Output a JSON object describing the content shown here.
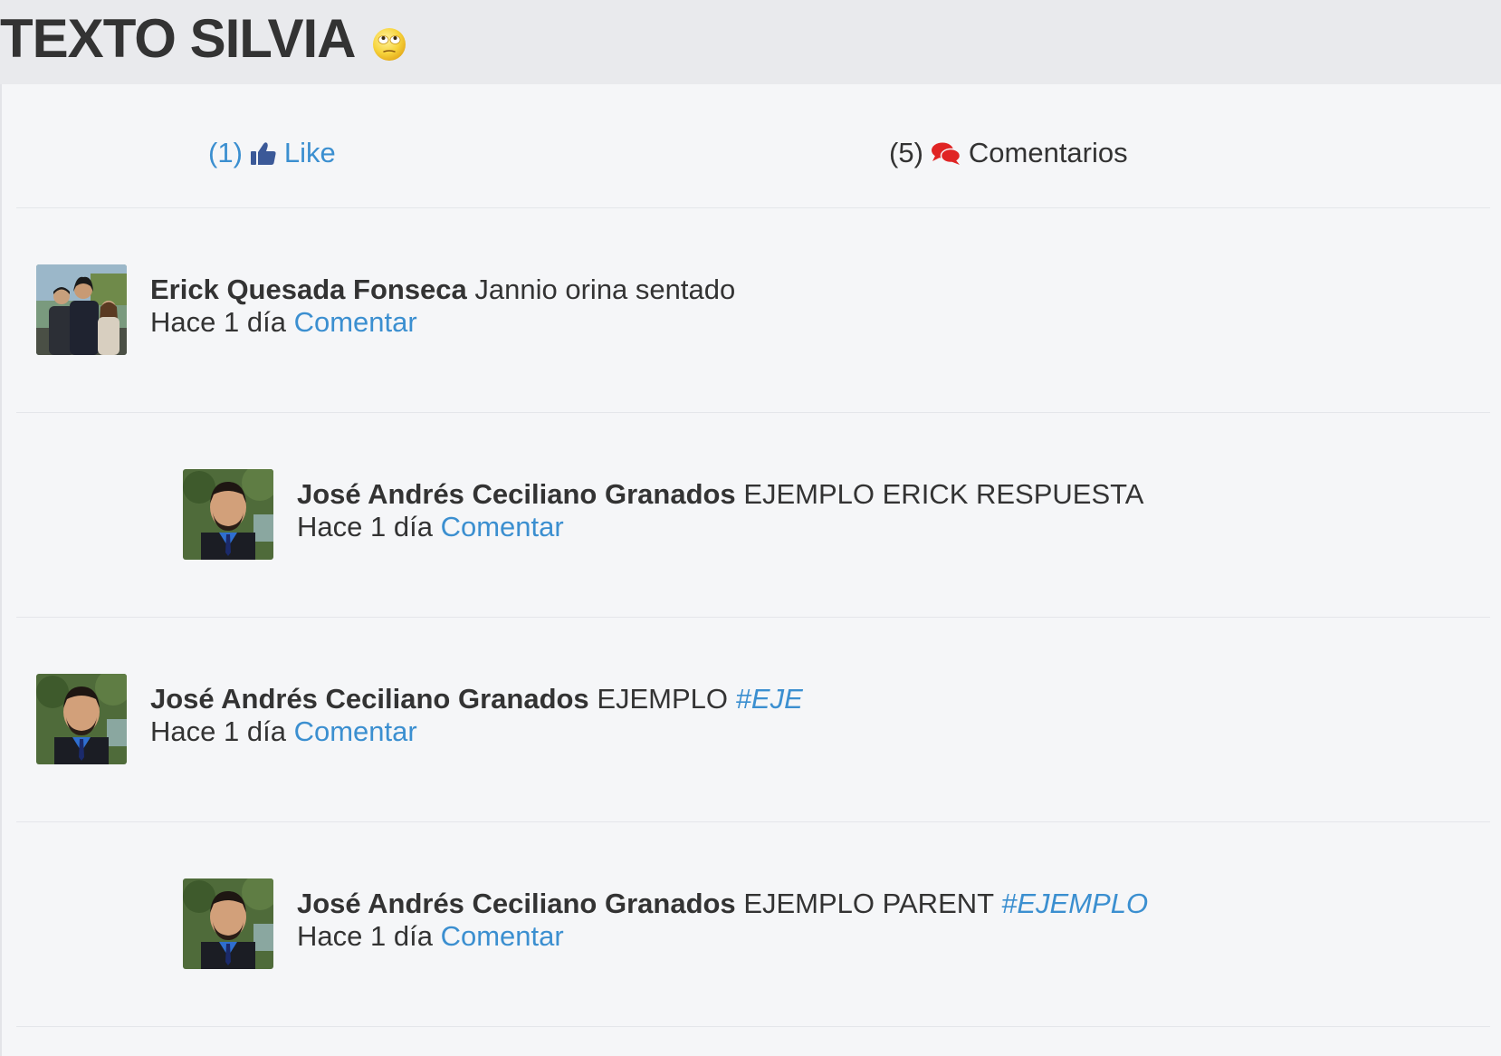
{
  "post": {
    "title": "TEXTO SILVIA",
    "emoji_icon": "rolling-eyes-emoji-icon"
  },
  "actions": {
    "like_count": "(1)",
    "like_label": "Like",
    "like_icon": "thumbs-up-icon",
    "comments_count": "(5)",
    "comments_label": "Comentarios",
    "comments_icon": "speech-bubbles-icon"
  },
  "colors": {
    "link": "#3b8fd0",
    "comments_icon": "#e02424",
    "header_bg": "#e9eaed",
    "page_bg": "#f5f6f8"
  },
  "comments": [
    {
      "author": "Erick Quesada Fonseca",
      "text": "Jannio orina sentado",
      "hashtag": "",
      "time": "Hace 1 día",
      "reply_label": "Comentar"
    },
    {
      "author": "José Andrés Ceciliano Granados",
      "text": "EJEMPLO ERICK RESPUESTA",
      "hashtag": "",
      "time": "Hace 1 día",
      "reply_label": "Comentar"
    },
    {
      "author": "José Andrés Ceciliano Granados",
      "text": "EJEMPLO",
      "hashtag": "#EJE",
      "time": "Hace 1 día",
      "reply_label": "Comentar"
    },
    {
      "author": "José Andrés Ceciliano Granados",
      "text": "EJEMPLO PARENT",
      "hashtag": "#EJEMPLO",
      "time": "Hace 1 día",
      "reply_label": "Comentar"
    }
  ]
}
